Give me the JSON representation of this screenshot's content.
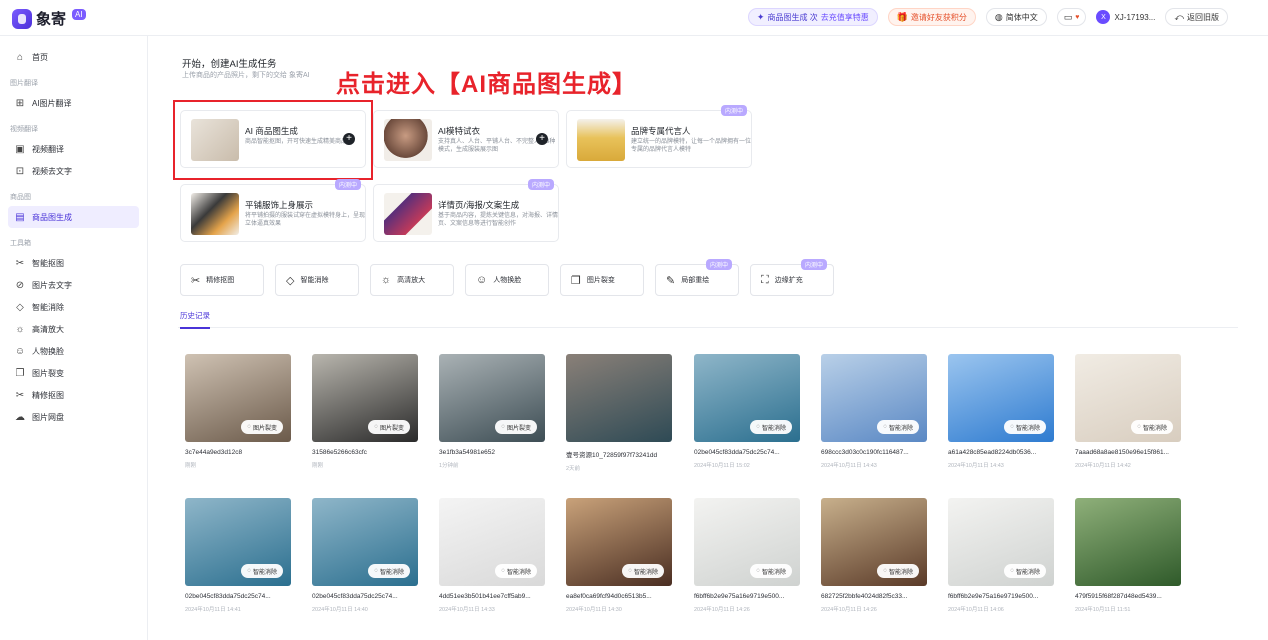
{
  "app": {
    "name": "象寄",
    "badge": "AI"
  },
  "topbar": {
    "promo": {
      "text": "商品图生成 次",
      "accent": "去充值享特惠"
    },
    "invite": "邀请好友获积分",
    "language": "简体中文",
    "user": {
      "avatar": "X",
      "name": "XJ-17193..."
    },
    "back_old": "返回旧版"
  },
  "sidebar": {
    "home": "首页",
    "groups": [
      {
        "title": "图片翻译",
        "items": [
          {
            "label": "AI图片翻译",
            "icon": "image-translate-icon"
          }
        ]
      },
      {
        "title": "视频翻译",
        "items": [
          {
            "label": "视频翻译",
            "icon": "video-translate-icon"
          },
          {
            "label": "视频去文字",
            "icon": "video-remove-text-icon"
          }
        ]
      },
      {
        "title": "商品图",
        "items": [
          {
            "label": "商品图生成",
            "icon": "product-image-icon"
          }
        ]
      },
      {
        "title": "工具箱",
        "items": [
          {
            "label": "智能抠图",
            "icon": "scissors-icon"
          },
          {
            "label": "图片去文字",
            "icon": "remove-text-icon"
          },
          {
            "label": "智能消除",
            "icon": "eraser-icon"
          },
          {
            "label": "高清放大",
            "icon": "sun-icon"
          },
          {
            "label": "人物换脸",
            "icon": "face-icon"
          },
          {
            "label": "图片裂变",
            "icon": "copy-icon"
          },
          {
            "label": "精修抠图",
            "icon": "scissors-icon"
          },
          {
            "label": "图片网盘",
            "icon": "cloud-icon"
          }
        ]
      }
    ]
  },
  "main": {
    "title": "开始，创建AI生成任务",
    "subtitle": "上传商品的产品照片，剩下的交给 象寄AI",
    "annotation": "点击进入【AI商品图生成】",
    "cards": [
      {
        "title": "AI 商品图生成",
        "desc": "商品智能抠图，开可快速生成精美商品图",
        "badge": "",
        "plus": "+"
      },
      {
        "title": "AI模特试衣",
        "desc": "支持真人、人台、平铺人台、不完整人台3种模式，生成服装展示图",
        "badge": "",
        "plus": "+"
      },
      {
        "title": "品牌专属代言人",
        "desc": "建立统一的品牌模特，让每一个品牌拥有一位专属的品牌代言人模特",
        "badge": "内测中",
        "plus": ""
      },
      {
        "title": "平铺服饰上身展示",
        "desc": "将平铺拍摄的服装试穿在虚拟模特身上，呈现立体逼真效果",
        "badge": "内测中",
        "plus": ""
      },
      {
        "title": "详情页/海报/文案生成",
        "desc": "基于商品内容，提炼关键信息，对海报、详情页、文案信息等进行智能创作",
        "badge": "内测中",
        "plus": ""
      }
    ],
    "tools": [
      {
        "label": "精修抠图",
        "icon": "scissors-icon",
        "badge": ""
      },
      {
        "label": "智能消除",
        "icon": "eraser-icon",
        "badge": ""
      },
      {
        "label": "高清放大",
        "icon": "sun-icon",
        "badge": ""
      },
      {
        "label": "人物换脸",
        "icon": "face-icon",
        "badge": ""
      },
      {
        "label": "图片裂变",
        "icon": "copy-icon",
        "badge": ""
      },
      {
        "label": "局部重绘",
        "icon": "brush-icon",
        "badge": "内测中"
      },
      {
        "label": "边缘扩充",
        "icon": "expand-icon",
        "badge": "内测中"
      }
    ],
    "history_tab": "历史记录",
    "history": [
      {
        "name": "3c7e44a9ed3d12c8",
        "time": "刚刚",
        "tag": "图片裂变",
        "colors": [
          "#6b5a4a",
          "#cfc2b3"
        ]
      },
      {
        "name": "31586e5266c63cfc",
        "time": "刚刚",
        "tag": "图片裂变",
        "colors": [
          "#2a2a2a",
          "#b9b6ae"
        ]
      },
      {
        "name": "3e1fb3a54981e652",
        "time": "1分钟前",
        "tag": "图片裂变",
        "colors": [
          "#3d4d54",
          "#aab2b5"
        ]
      },
      {
        "name": "壹号资源10_72859f97f73241dd",
        "time": "2天前",
        "tag": "",
        "colors": [
          "#2e4a55",
          "#8a8078"
        ]
      },
      {
        "name": "02be045cf83dda75dc25c74...",
        "time": "2024年10月11日 15:02",
        "tag": "智能消除",
        "colors": [
          "#2b6f8f",
          "#8fb6c9"
        ]
      },
      {
        "name": "698ccc3d03c0c190fc116487...",
        "time": "2024年10月11日 14:43",
        "tag": "智能消除",
        "colors": [
          "#5a88c4",
          "#b9d0e8"
        ]
      },
      {
        "name": "a61a428c85ead8224db0536...",
        "time": "2024年10月11日 14:43",
        "tag": "智能消除",
        "colors": [
          "#2e7bd0",
          "#9bc5ef"
        ]
      },
      {
        "name": "7aaad68a8ae8150e96e15f861...",
        "time": "2024年10月11日 14:42",
        "tag": "智能消除",
        "colors": [
          "#d8cdbf",
          "#f1ece4"
        ]
      },
      {
        "name": "02be045cf83dda75dc25c74...",
        "time": "2024年10月11日 14:41",
        "tag": "智能消除",
        "colors": [
          "#2b6f8f",
          "#8fb6c9"
        ]
      },
      {
        "name": "02be045cf83dda75dc25c74...",
        "time": "2024年10月11日 14:40",
        "tag": "智能消除",
        "colors": [
          "#2b6f8f",
          "#8fb6c9"
        ]
      },
      {
        "name": "4dd51ee3b501b41ee7cff5ab9...",
        "time": "2024年10月11日 14:33",
        "tag": "智能消除",
        "colors": [
          "#d9d9d9",
          "#f4f4f4"
        ]
      },
      {
        "name": "ea8ef0ca69fcf94d0c6513b5...",
        "time": "2024年10月11日 14:30",
        "tag": "智能消除",
        "colors": [
          "#4a2e22",
          "#c9a27a"
        ]
      },
      {
        "name": "f6bff6b2e9e75a16e9719e500...",
        "time": "2024年10月11日 14:26",
        "tag": "智能消除",
        "colors": [
          "#cfd2d0",
          "#f3f3f1"
        ]
      },
      {
        "name": "682725f2bbfe4024d82f5c33...",
        "time": "2024年10月11日 14:26",
        "tag": "智能消除",
        "colors": [
          "#5a3a28",
          "#c8b08c"
        ]
      },
      {
        "name": "f6bff6b2e9e75a16e9719e500...",
        "time": "2024年10月11日 14:06",
        "tag": "智能消除",
        "colors": [
          "#cfd2d0",
          "#f3f3f1"
        ]
      },
      {
        "name": "479f5915f68f287d48ed5439...",
        "time": "2024年10月11日 11:51",
        "tag": "",
        "colors": [
          "#2f5a2a",
          "#8fb07a"
        ]
      }
    ]
  }
}
